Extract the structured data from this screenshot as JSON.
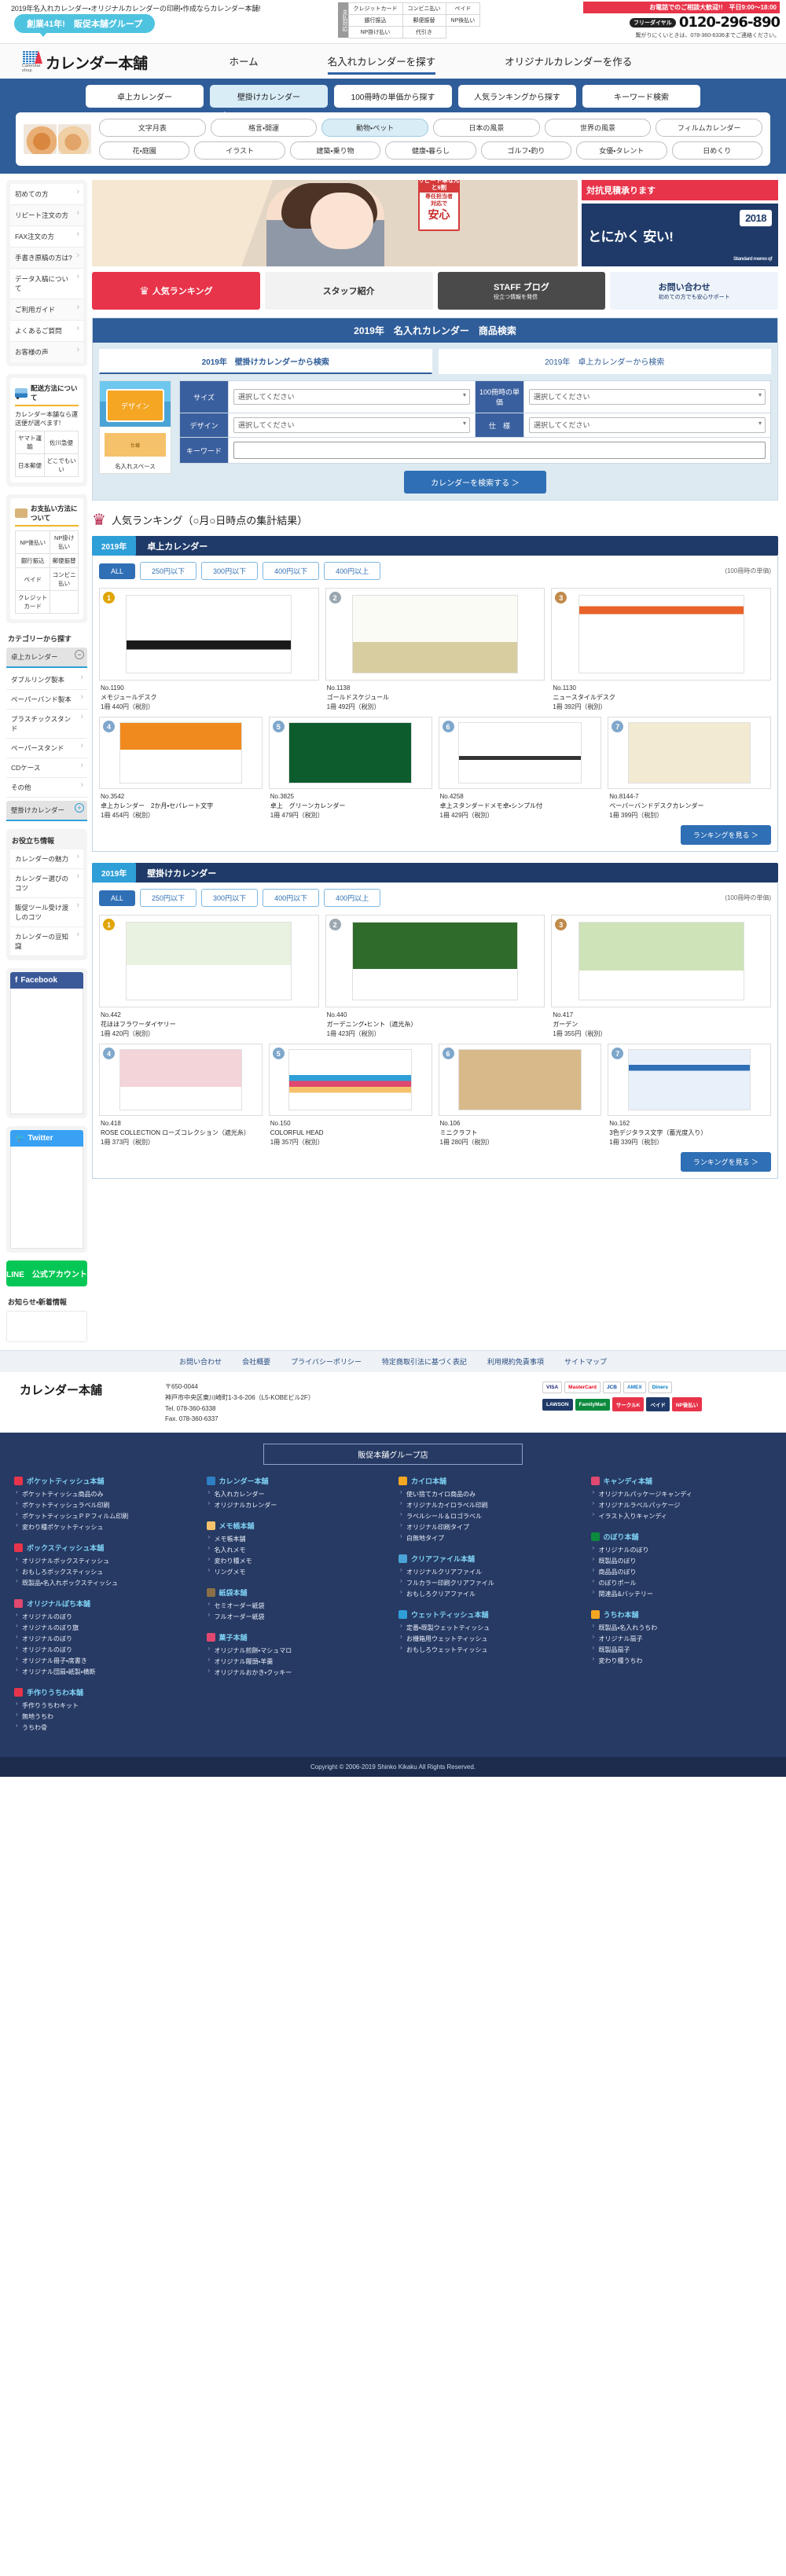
{
  "topbar": {
    "catchcopy": "2019年名入れカレンダー・オリジナルカレンダーの印刷・作成ならカレンダー本舗!",
    "since_badge": "創業41年!　販促本舗グループ",
    "payment_label": "支払対応",
    "payment_methods": [
      "クレジットカード",
      "コンビニ払い",
      "ペイド",
      "銀行振込",
      "郵便振替",
      "NP後払い",
      "NP掛け払い",
      "代引き"
    ],
    "tel_headline": "お電話でのご相談大歓迎!!　平日9:00～18:00",
    "tel_headline_em": "平日9:00～18:00",
    "freedial_label": "フリーダイヤル",
    "tel_number": "0120-296-890",
    "tel_note": "繋がりにくいときは、078-360-6336までご連絡ください。"
  },
  "header": {
    "logo_name": "カレンダー本舗",
    "logo_sub": "Calendar shop",
    "nav": [
      {
        "label": "ホーム",
        "active": false
      },
      {
        "label": "名入れカレンダーを探す",
        "active": true
      },
      {
        "label": "オリジナルカレンダーを作る",
        "active": false
      }
    ]
  },
  "bluenav": {
    "tabs": [
      {
        "label": "卓上カレンダー",
        "selected": false
      },
      {
        "label": "壁掛けカレンダー",
        "selected": true
      },
      {
        "label": "100冊時の単価から探す",
        "selected": false
      },
      {
        "label": "人気ランキングから探す",
        "selected": false
      },
      {
        "label": "キーワード検索",
        "selected": false
      }
    ],
    "chips_row1": [
      {
        "label": "文字月表",
        "selected": false
      },
      {
        "label": "格言・開運",
        "selected": false
      },
      {
        "label": "動物・ペット",
        "selected": true
      },
      {
        "label": "日本の風景",
        "selected": false
      },
      {
        "label": "世界の風景",
        "selected": false
      },
      {
        "label": "フィルムカレンダー",
        "selected": false
      }
    ],
    "chips_row2": [
      {
        "label": "花・庭園",
        "selected": false
      },
      {
        "label": "イラスト",
        "selected": false
      },
      {
        "label": "建築・乗り物",
        "selected": false
      },
      {
        "label": "健康・暮らし",
        "selected": false
      },
      {
        "label": "ゴルフ・釣り",
        "selected": false
      },
      {
        "label": "女優・タレント",
        "selected": false
      },
      {
        "label": "日めくり",
        "selected": false
      }
    ]
  },
  "sidebar": {
    "guide_items": [
      "初めての方",
      "リピート注文の方",
      "FAX注文の方",
      "手書き原稿の方は?",
      "データ入稿について",
      "ご利用ガイド",
      "よくあるご質問",
      "お客様の声"
    ],
    "shipping": {
      "title": "配送方法について",
      "text": "カレンダー本舗なら運送便が選べます!",
      "rows": [
        [
          "ヤマト運輸",
          "佐川急便"
        ],
        [
          "日本郵便",
          "どこでもいい"
        ]
      ]
    },
    "payment": {
      "title": "お支払い方法について",
      "rows": [
        [
          "NP後払い",
          "NP掛け払い"
        ],
        [
          "銀行振込",
          "郵便振替"
        ],
        [
          "ペイド",
          "コンビニ払い"
        ],
        [
          "クレジットカード",
          ""
        ]
      ]
    },
    "category": {
      "title": "カテゴリーから探す",
      "open_group": "卓上カレンダー",
      "open_items": [
        "ダブルリング製本",
        "ペーパーバンド製本",
        "プラスチックスタンド",
        "ペーパースタンド",
        "CDケース",
        "その他"
      ],
      "closed_group": "壁掛けカレンダー"
    },
    "useful": {
      "title": "お役立ち情報",
      "items": [
        "カレンダーの魅力",
        "カレンダー選びのコツ",
        "販促ツール受け渡しのコツ",
        "カレンダーの豆知識"
      ]
    },
    "facebook_title": "Facebook",
    "twitter_title": "Twitter",
    "line_title": "LINE　公式アカウント",
    "news_title": "お知らせ・新着情報"
  },
  "hero": {
    "badge_cap": "リピート率なんと9割",
    "badge_line1": "専任担当者",
    "badge_line2": "対応で",
    "badge_big": "安心",
    "right_top": "対抗見積承ります",
    "right_big": "とにかく 安い!",
    "right_year": "2018",
    "right_note": "Standard memo qf"
  },
  "banners": [
    {
      "label": "人気ランキング",
      "style": "b1",
      "icon": "crown-icon"
    },
    {
      "label": "スタッフ紹介",
      "style": "b2",
      "icon": "staff-icon"
    },
    {
      "label": "STAFF ブログ",
      "sub": "役立つ情報を発信",
      "style": "b3",
      "icon": "blog-icon"
    },
    {
      "label": "お問い合わせ",
      "sub": "初めての方でも安心サポート",
      "style": "b4",
      "icon": "mail-icon"
    }
  ],
  "search_panel": {
    "title": "2019年　名入れカレンダー　商品検索",
    "tabs": [
      {
        "label": "2019年　壁掛けカレンダーから検索",
        "selected": true
      },
      {
        "label": "2019年　卓上カレンダーから検索",
        "selected": false
      }
    ],
    "thumb_design_label": "デザイン",
    "thumb_spec_label": "仕様",
    "thumb_caption": "名入れスペース",
    "fields": [
      {
        "label": "サイズ",
        "placeholder": "選択してください"
      },
      {
        "label": "100冊時の単価",
        "placeholder": "選択してください"
      },
      {
        "label": "デザイン",
        "placeholder": "選択してください"
      },
      {
        "label": "仕　様",
        "placeholder": "選択してください"
      },
      {
        "label": "キーワード",
        "value": ""
      }
    ],
    "submit_label": "カレンダーを検索する ＞"
  },
  "ranking": {
    "heading": "人気ランキング（○月○日時点の集計結果）",
    "sections": [
      {
        "year": "2019年",
        "title": "卓上カレンダー",
        "filters": [
          {
            "label": "ALL",
            "selected": true
          },
          {
            "label": "250円以下",
            "selected": false
          },
          {
            "label": "300円以下",
            "selected": false
          },
          {
            "label": "400円以下",
            "selected": false
          },
          {
            "label": "400円以上",
            "selected": false
          }
        ],
        "unit_note": "(100冊時の単価)",
        "row1": [
          {
            "rank": "1",
            "no": "No.1190",
            "name": "メモジュールデスク",
            "price": "1冊 440円（税別）",
            "art": "memo"
          },
          {
            "rank": "2",
            "no": "No.1138",
            "name": "ゴールドスケジュール",
            "price": "1冊 492円（税別）",
            "art": "gold"
          },
          {
            "rank": "3",
            "no": "No.1130",
            "name": "ニュースタイルデスク",
            "price": "1冊 392円（税別）",
            "art": "newstyle"
          }
        ],
        "row2": [
          {
            "rank": "4",
            "no": "No.3542",
            "name": "卓上カレンダー　2か月・セパレート文字",
            "price": "1冊 454円（税別）",
            "art": "orange"
          },
          {
            "rank": "5",
            "no": "No.3825",
            "name": "卓上　グリーンカレンダー",
            "price": "1冊 479円（税別）",
            "art": "green"
          },
          {
            "rank": "6",
            "no": "No.4258",
            "name": "卓上スタンダードメモ卓・シンプル付",
            "price": "1冊 429円（税別）",
            "art": "simple"
          },
          {
            "rank": "7",
            "no": "No.8144-7",
            "name": "ペーパーバンドデスクカレンダー",
            "price": "1冊 399円（税別）",
            "art": "paper"
          }
        ],
        "more_label": "ランキングを見る ＞"
      },
      {
        "year": "2019年",
        "title": "壁掛けカレンダー",
        "filters": [
          {
            "label": "ALL",
            "selected": true
          },
          {
            "label": "250円以下",
            "selected": false
          },
          {
            "label": "300円以下",
            "selected": false
          },
          {
            "label": "400円以下",
            "selected": false
          },
          {
            "label": "400円以上",
            "selected": false
          }
        ],
        "unit_note": "(100冊時の単価)",
        "row1": [
          {
            "rank": "1",
            "no": "No.442",
            "name": "花ほほフラワーダイヤリー",
            "price": "1冊 420円（税別）",
            "art": "flower"
          },
          {
            "rank": "2",
            "no": "No.440",
            "name": "ガーデニング・ヒント（遮光糸）",
            "price": "1冊 423円（税別）",
            "art": "garden"
          },
          {
            "rank": "3",
            "no": "No.417",
            "name": "ガーデン",
            "price": "1冊 355円（税別）",
            "art": "gardens"
          }
        ],
        "row2": [
          {
            "rank": "4",
            "no": "No.418",
            "name": "ROSE COLLECTION ローズコレクション（遮光糸）",
            "price": "1冊 373円（税別）",
            "art": "rose"
          },
          {
            "rank": "5",
            "no": "No.150",
            "name": "COLORFUL HEAD",
            "price": "1冊 357円（税別）",
            "art": "colorful"
          },
          {
            "rank": "6",
            "no": "No.106",
            "name": "ミニクラフト",
            "price": "1冊 280円（税別）",
            "art": "kraft"
          },
          {
            "rank": "7",
            "no": "No.162",
            "name": "3色デジタラス文字（蓄光度入り）",
            "price": "1冊 339円（税別）",
            "art": "blue"
          }
        ],
        "more_label": "ランキングを見る ＞"
      }
    ]
  },
  "footer": {
    "nav": [
      "お問い合わせ",
      "会社概要",
      "プライバシーポリシー",
      "特定商取引法に基づく表記",
      "利用規約免責事項",
      "サイトマップ"
    ],
    "logo_name": "カレンダー本舗",
    "address_lines": [
      "〒650-0044",
      "神戸市中央区東川崎町1-3-6-206（L5-KOBEビル2F）",
      "Tel. 078-360-6338",
      "Fax. 078-360-6337"
    ],
    "pay_badges_row1": [
      "VISA",
      "MasterCard",
      "JCB",
      "AMEX",
      "Diners"
    ],
    "pay_badges_row2": [
      "LAWSON",
      "FamilyMart",
      "サークルK",
      "ペイド",
      "NP後払い"
    ],
    "group_title": "販促本舗グループ店",
    "groups": [
      {
        "name": "ポケットティッシュ本舗",
        "color": "#e8344a",
        "items": [
          "ポケットティッシュ商品のみ",
          "ポケットティッシュラベル印刷",
          "ポケットティッシュＰＰフィルム印刷",
          "変わり種ポケットティッシュ"
        ]
      },
      {
        "name": "カレンダー本舗",
        "color": "#2f7fc4",
        "items": [
          "名入れカレンダー",
          "オリジナルカレンダー"
        ]
      },
      {
        "name": "カイロ本舗",
        "color": "#f5a623",
        "items": [
          "使い捨てカイロ商品のみ",
          "オリジナルカイロラベル印刷",
          "ラベルシール＆ロゴラベル",
          "オリジナル印刷タイプ",
          "白無地タイプ"
        ]
      },
      {
        "name": "キャンディ本舗",
        "color": "#e0486f",
        "items": [
          "オリジナルパッケージキャンディ",
          "オリジナルラベルパッケージ",
          "イラスト入りキャンディ"
        ]
      },
      {
        "name": "ボックスティッシュ本舗",
        "color": "#e8344a",
        "items": [
          "オリジナルボックスティッシュ",
          "おもしろボックスティッシュ",
          "既製品・名入れボックスティッシュ"
        ]
      },
      {
        "name": "メモ帳本舗",
        "color": "#f5c26b",
        "items": [
          "メモ帳本舗",
          "名入れメモ",
          "変わり種メモ",
          "リングメモ"
        ]
      },
      {
        "name": "クリアファイル本舗",
        "color": "#4aa3d6",
        "items": [
          "オリジナルクリアファイル",
          "フルカラー印刷クリアファイル",
          "おもしろクリアファイル"
        ]
      },
      {
        "name": "のぼり本舗",
        "color": "#0b8a3e",
        "items": [
          "オリジナルのぼり",
          "既製品のぼり",
          "商品品のぼり",
          "のぼりポール",
          "関連品&バッテリー"
        ]
      },
      {
        "name": "オリジナルぽち本舗",
        "color": "#e0486f",
        "items": [
          "オリジナルのぼり",
          "オリジナルのぼり旗",
          "オリジナルのぼり",
          "オリジナルのぼり",
          "オリジナル冊子・席書き",
          "オリジナル団扇・紙製・横断"
        ]
      },
      {
        "name": "紙袋本舗",
        "color": "#8b6f47",
        "items": [
          "セミオーダー紙袋",
          "フルオーダー紙袋"
        ]
      },
      {
        "name": "ウェットティッシュ本舗",
        "color": "#2f9fd8",
        "items": [
          "定番・既製ウェットティッシュ",
          "お機箱用ウェットティッシュ",
          "おもしろウェットティッシュ"
        ]
      },
      {
        "name": "うちわ本舗",
        "color": "#f5a623",
        "items": [
          "既製品・名入れうちわ",
          "オリジナル扇子",
          "既製品扇子",
          "変わり種うちわ"
        ]
      },
      {
        "name": "手作りうちわ本舗",
        "color": "#e8344a",
        "items": [
          "手作りうちわキット",
          "無地うちわ",
          "うちわ骨"
        ]
      },
      {
        "name": "菓子本舗",
        "color": "#e0486f",
        "items": [
          "オリジナル煎餅・マシュマロ",
          "オリジナル饅頭・羊羹",
          "オリジナルおかき・クッキー"
        ]
      }
    ],
    "copyright": "Copyright © 2006-2019 Shinko Kikaku All Rights Reserved."
  }
}
